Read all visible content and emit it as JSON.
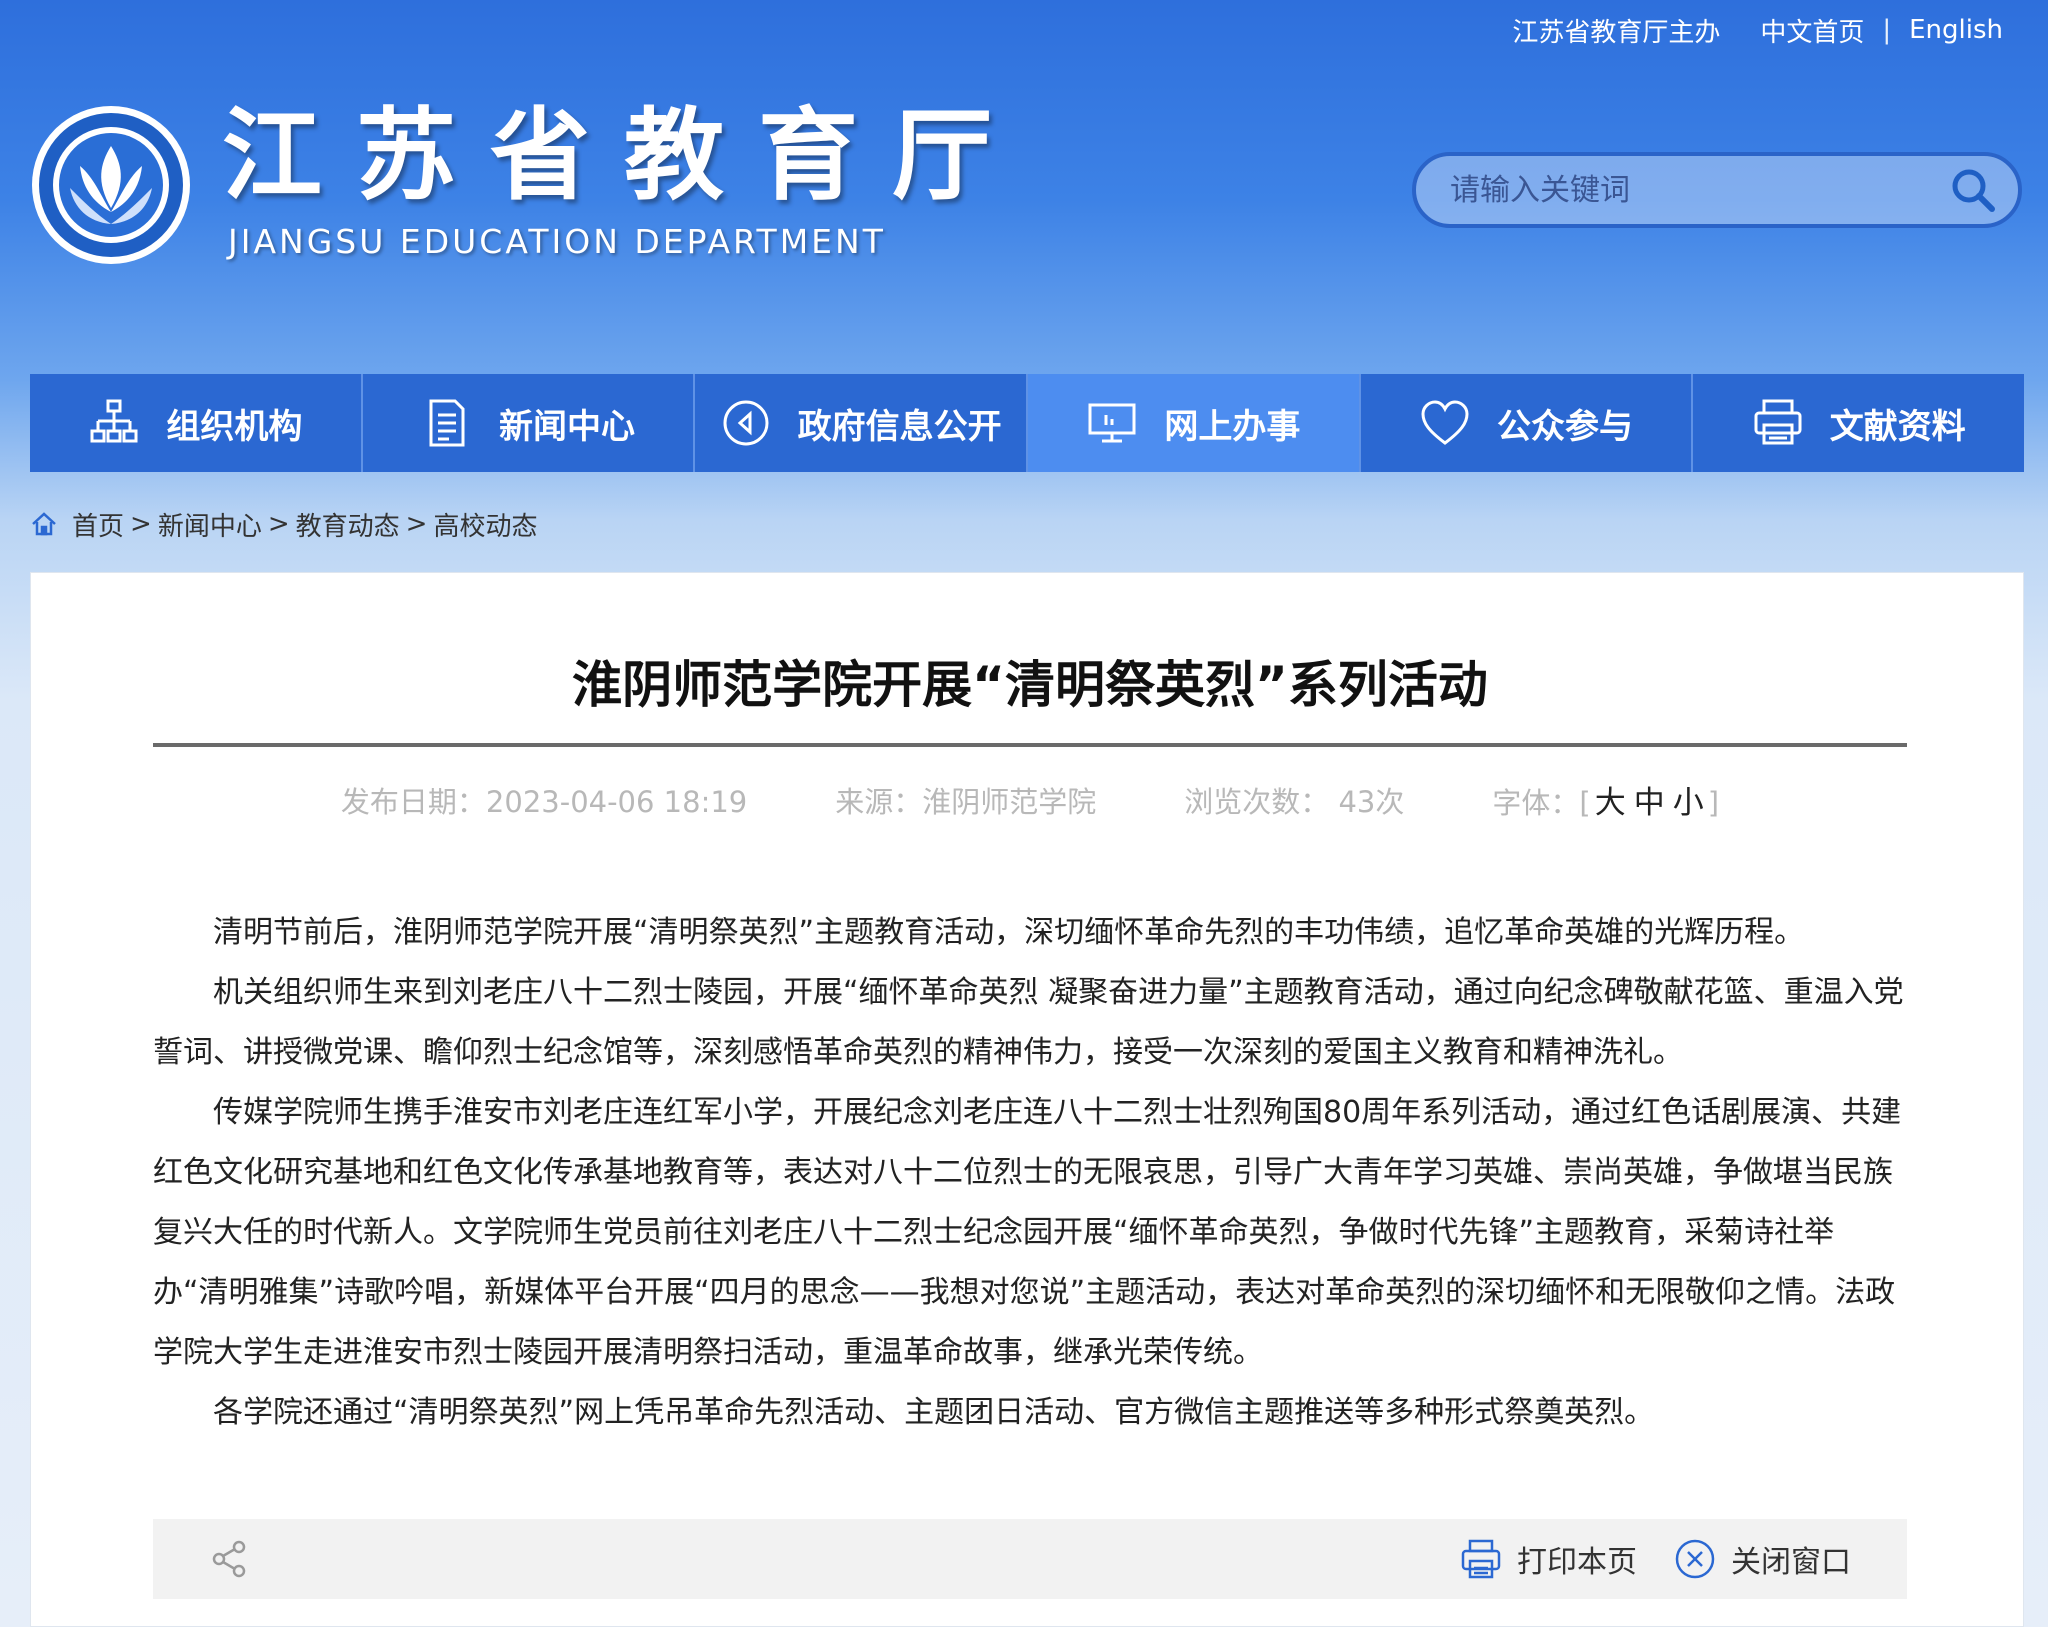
{
  "header": {
    "host": "江苏省教育厅主办",
    "links": [
      "中文首页",
      "English"
    ],
    "title": "江苏省教育厅",
    "subtitle": "JIANGSU EDUCATION DEPARTMENT"
  },
  "search": {
    "placeholder": "请输入关键词"
  },
  "nav": [
    {
      "label": "组织机构",
      "icon": "org-chart-icon"
    },
    {
      "label": "新闻中心",
      "icon": "document-icon"
    },
    {
      "label": "政府信息公开",
      "icon": "play-circle-icon"
    },
    {
      "label": "网上办事",
      "icon": "monitor-icon",
      "active": true
    },
    {
      "label": "公众参与",
      "icon": "heart-icon"
    },
    {
      "label": "文献资料",
      "icon": "printer-stack-icon"
    }
  ],
  "breadcrumb": [
    "首页",
    "新闻中心",
    "教育动态",
    "高校动态"
  ],
  "article": {
    "title": "淮阴师范学院开展“清明祭英烈”系列活动",
    "meta": {
      "date": "发布日期：2023-04-06 18:19",
      "source": "来源：淮阴师范学院",
      "views": "浏览次数： 43次",
      "font_label": "字体：",
      "font_open": "[",
      "font_close": "]",
      "font_large": "大",
      "font_medium": "中",
      "font_small": "小"
    },
    "paragraphs": [
      "清明节前后，淮阴师范学院开展“清明祭英烈”主题教育活动，深切缅怀革命先烈的丰功伟绩，追忆革命英雄的光辉历程。",
      "机关组织师生来到刘老庄八十二烈士陵园，开展“缅怀革命英烈 凝聚奋进力量”主题教育活动，通过向纪念碑敬献花篮、重温入党誓词、讲授微党课、瞻仰烈士纪念馆等，深刻感悟革命英烈的精神伟力，接受一次深刻的爱国主义教育和精神洗礼。",
      "传媒学院师生携手淮安市刘老庄连红军小学，开展纪念刘老庄连八十二烈士壮烈殉国80周年系列活动，通过红色话剧展演、共建红色文化研究基地和红色文化传承基地教育等，表达对八十二位烈士的无限哀思，引导广大青年学习英雄、崇尚英雄，争做堪当民族复兴大任的时代新人。文学院师生党员前往刘老庄八十二烈士纪念园开展“缅怀革命英烈，争做时代先锋”主题教育，采菊诗社举办“清明雅集”诗歌吟唱，新媒体平台开展“四月的思念——我想对您说”主题活动，表达对革命英烈的深切缅怀和无限敬仰之情。法政学院大学生走进淮安市烈士陵园开展清明祭扫活动，重温革命故事，继承光荣传统。",
      "各学院还通过“清明祭英烈”网上凭吊革命先烈活动、主题团日活动、官方微信主题推送等多种形式祭奠英烈。"
    ]
  },
  "tools": {
    "print": "打印本页",
    "close": "关闭窗口"
  },
  "colors": {
    "nav_bg": "#2b68d2",
    "nav_active": "#4d8df0"
  }
}
